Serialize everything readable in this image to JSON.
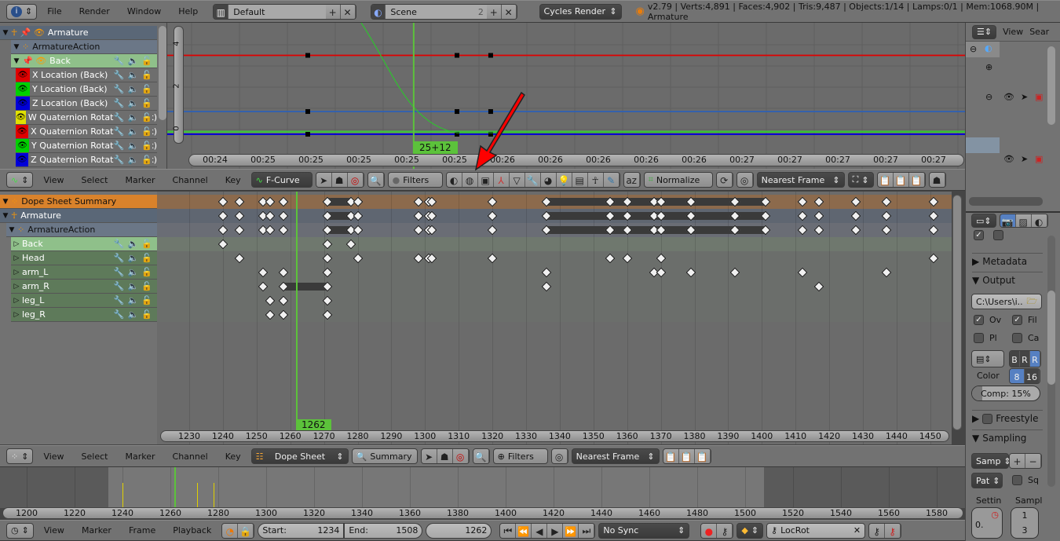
{
  "info_header": {
    "menus": [
      "File",
      "Render",
      "Window",
      "Help"
    ],
    "screen_layout": "Default",
    "scene": "Scene",
    "scene_users": "2",
    "render_engine": "Cycles Render",
    "stats": "v2.79 | Verts:4,891 | Faces:4,902 | Tris:9,487 | Objects:1/14 | Lamps:0/1 | Mem:1068.90M | Armature"
  },
  "graph_editor": {
    "channels": [
      {
        "label": "Armature",
        "type": "object"
      },
      {
        "label": "ArmatureAction",
        "type": "action"
      },
      {
        "label": "Back",
        "type": "group"
      },
      {
        "label": "X Location (Back)",
        "color": "#e00000"
      },
      {
        "label": "Y Location (Back)",
        "color": "#00d000"
      },
      {
        "label": "Z Location (Back)",
        "color": "#0000d8"
      },
      {
        "label": "W Quaternion Rotation (Back)",
        "color": "#e0e000"
      },
      {
        "label": "X Quaternion Rotation (Back)",
        "color": "#e00000"
      },
      {
        "label": "Y Quaternion Rotation (Back)",
        "color": "#00d000"
      },
      {
        "label": "Z Quaternion Rotation (Back)",
        "color": "#0000d8"
      }
    ],
    "y_ticks": [
      "4",
      "2",
      "0"
    ],
    "x_ticks": [
      "00:24",
      "00:25",
      "00:25",
      "00:25",
      "00:25",
      "00:25",
      "00:26",
      "00:26",
      "00:26",
      "00:26",
      "00:26",
      "00:27",
      "00:27",
      "00:27",
      "00:27",
      "00:27"
    ],
    "current_frame_label": "25+12",
    "curves": [
      {
        "color": "#e00000",
        "keys": [
          [
            1240,
            3.5
          ],
          [
            1271,
            3.5
          ],
          [
            1278,
            3.5
          ]
        ]
      },
      {
        "color": "#3060b0",
        "keys": [
          [
            1240,
            0.85
          ],
          [
            1271,
            0.85
          ],
          [
            1278,
            0.85
          ]
        ]
      },
      {
        "color": "#40c040",
        "keys": [
          [
            1240,
            -0.1
          ],
          [
            1278,
            -0.1
          ]
        ]
      },
      {
        "color": "#0000d8",
        "keys": [
          [
            1240,
            -0.22
          ],
          [
            1271,
            -0.22
          ],
          [
            1278,
            -0.22
          ]
        ]
      }
    ],
    "header": {
      "menus": [
        "View",
        "Select",
        "Marker",
        "Channel",
        "Key"
      ],
      "mode": "F-Curve",
      "filters": "Filters",
      "normalize": "Normalize",
      "snap": "Nearest Frame"
    }
  },
  "dope_sheet": {
    "channels": [
      {
        "label": "Dope Sheet Summary",
        "type": "summary"
      },
      {
        "label": "Armature",
        "type": "object"
      },
      {
        "label": "ArmatureAction",
        "type": "action"
      },
      {
        "label": "Back",
        "type": "group"
      },
      {
        "label": "Head",
        "type": "bone"
      },
      {
        "label": "arm_L",
        "type": "bone"
      },
      {
        "label": "arm_R",
        "type": "bone"
      },
      {
        "label": "leg_L",
        "type": "bone"
      },
      {
        "label": "leg_R",
        "type": "bone"
      }
    ],
    "keyframes": [
      [
        1240,
        1245,
        1252,
        1254,
        1258,
        1271,
        1278,
        1280,
        1298,
        1301,
        1302,
        1320,
        1336,
        1355,
        1360,
        1368,
        1370,
        1379,
        1392,
        1401,
        1412,
        1417,
        1428,
        1437,
        1451
      ],
      [
        1240,
        1245,
        1252,
        1254,
        1258,
        1271,
        1278,
        1280,
        1298,
        1301,
        1302,
        1320,
        1336,
        1355,
        1360,
        1368,
        1370,
        1379,
        1392,
        1401,
        1412,
        1417,
        1428,
        1437,
        1451
      ],
      [
        1240,
        1245,
        1252,
        1254,
        1258,
        1271,
        1278,
        1280,
        1298,
        1301,
        1302,
        1320,
        1336,
        1355,
        1360,
        1368,
        1370,
        1379,
        1392,
        1401,
        1412,
        1417,
        1428,
        1437,
        1451
      ],
      [
        1240,
        1271,
        1278
      ],
      [
        1245,
        1271,
        1280,
        1298,
        1301,
        1302,
        1320,
        1355,
        1360,
        1370,
        1451
      ],
      [
        1252,
        1258,
        1271,
        1336,
        1368,
        1370,
        1379,
        1392,
        1412,
        1437
      ],
      [
        1252,
        1258,
        1271,
        1336,
        1417
      ],
      [
        1254,
        1258,
        1271
      ],
      [
        1254,
        1258,
        1271
      ]
    ],
    "holds": [
      [
        [
          1271,
          1278
        ],
        [
          1336,
          1401
        ]
      ],
      [
        [
          1271,
          1278
        ],
        [
          1336,
          1401
        ]
      ],
      [
        [
          1271,
          1278
        ],
        [
          1336,
          1401
        ]
      ],
      [],
      [],
      [],
      [
        [
          1258,
          1271
        ]
      ],
      [],
      []
    ],
    "x_ticks": [
      "1230",
      "1240",
      "1250",
      "1260",
      "1270",
      "1280",
      "1290",
      "1300",
      "1310",
      "1320",
      "1330",
      "1340",
      "1350",
      "1360",
      "1370",
      "1380",
      "1390",
      "1400",
      "1410",
      "1420",
      "1430",
      "1440",
      "1450"
    ],
    "current_frame": "1262",
    "header": {
      "menus": [
        "View",
        "Select",
        "Marker",
        "Channel",
        "Key"
      ],
      "mode": "Dope Sheet",
      "summary": "Summary",
      "filters": "Filters",
      "snap": "Nearest Frame"
    }
  },
  "timeline": {
    "x_ticks": [
      "1200",
      "1220",
      "1240",
      "1260",
      "1280",
      "1300",
      "1320",
      "1340",
      "1360",
      "1380",
      "1400",
      "1420",
      "1440",
      "1460",
      "1480",
      "1500",
      "1520",
      "1540",
      "1560",
      "1580"
    ],
    "keyframe_markers": [
      1240,
      1271,
      1278
    ],
    "header": {
      "menus": [
        "View",
        "Marker",
        "Frame",
        "Playback"
      ],
      "start_label": "Start:",
      "start": "1234",
      "end_label": "End:",
      "end": "1508",
      "current": "1262",
      "sync": "No Sync",
      "keying_set": "LocRot"
    }
  },
  "outliner": {
    "menus": [
      "View",
      "Sear"
    ]
  },
  "properties": {
    "panels": {
      "metadata": "Metadata",
      "output": "Output",
      "freestyle": "Freestyle",
      "sampling": "Sampling"
    },
    "output_path": "C:\\Users\\i...",
    "checks": [
      {
        "label": "Ov",
        "checked": true
      },
      {
        "label": "Fil",
        "checked": true
      },
      {
        "label": "Pl",
        "checked": false
      },
      {
        "label": "Ca",
        "checked": false
      }
    ],
    "color_modes": [
      "B",
      "R",
      "R"
    ],
    "color_label": "Color",
    "color_depth": [
      "8",
      "16"
    ],
    "compression": "Comp: 15%",
    "compression_value": 15,
    "samp_preset": "Samp",
    "pat": "Pat",
    "sq": "Sq",
    "settings_label": "Settin",
    "samples_label": "Sampl",
    "settings_value": "0.",
    "samples_values": [
      "1",
      "3"
    ]
  },
  "annotation": {
    "arrow_color": "#ff0000"
  }
}
